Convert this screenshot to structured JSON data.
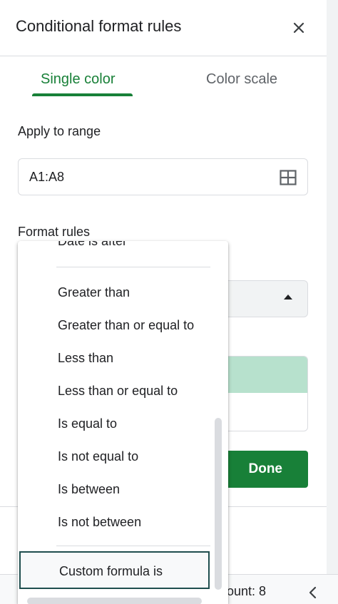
{
  "header": {
    "title": "Conditional format rules",
    "close_icon": "close-icon"
  },
  "tabs": [
    {
      "label": "Single color",
      "active": true
    },
    {
      "label": "Color scale",
      "active": false
    }
  ],
  "apply_range": {
    "label": "Apply to range",
    "value": "A1:A8",
    "icon": "grid-icon"
  },
  "format_rules": {
    "label": "Format rules"
  },
  "dropdown": {
    "partial_item": "Date is after",
    "items": [
      "Greater than",
      "Greater than or equal to",
      "Less than",
      "Less than or equal to",
      "Is equal to",
      "Is not equal to",
      "Is between",
      "Is not between"
    ],
    "selected": "Custom formula is"
  },
  "style_preview_color": "#b7e1cd",
  "done_label": "Done",
  "status": {
    "count": "ount: 8"
  },
  "colors": {
    "accent": "#188038",
    "selected_border": "#1f4e4e"
  }
}
